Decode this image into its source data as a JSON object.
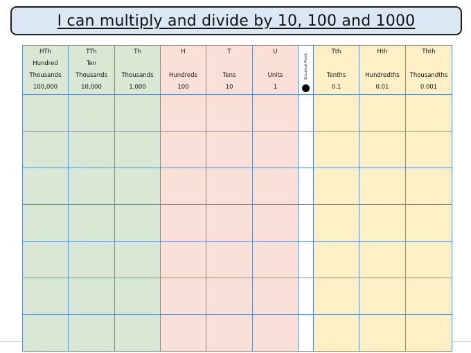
{
  "title": "I can multiply and divide by 10, 100 and 1000",
  "columns": [
    {
      "abbr": "HTh",
      "line2": "Hundred",
      "name": "Thousands",
      "value": "100,000",
      "group": "thousands"
    },
    {
      "abbr": "TTh",
      "line2": "Ten",
      "name": "Thousands",
      "value": "10,000",
      "group": "thousands"
    },
    {
      "abbr": "Th",
      "line2": "",
      "name": "Thousands",
      "value": "1,000",
      "group": "thousands"
    },
    {
      "abbr": "H",
      "line2": "",
      "name": "Hundreds",
      "value": "100",
      "group": "ones"
    },
    {
      "abbr": "T",
      "line2": "",
      "name": "Tens",
      "value": "10",
      "group": "ones"
    },
    {
      "abbr": "U",
      "line2": "",
      "name": "Units",
      "value": "1",
      "group": "ones"
    },
    {
      "abbr": "Tth",
      "line2": "",
      "name": "Tenths",
      "value": "0.1",
      "group": "decimals"
    },
    {
      "abbr": "Hth",
      "line2": "",
      "name": "Hundredths",
      "value": "0.01",
      "group": "decimals"
    },
    {
      "abbr": "Thth",
      "line2": "",
      "name": "Thousandths",
      "value": "0.001",
      "group": "decimals"
    }
  ],
  "decimal_point": {
    "label": "Decimal Point",
    "icon": "filled-circle"
  },
  "empty_rows": 7,
  "colors": {
    "thousands": "#d8e8d5",
    "ones": "#fae0d6",
    "decimals": "#fdf0c7",
    "grid": "#5b8fd0",
    "title_bg": "#dbe7f5"
  }
}
